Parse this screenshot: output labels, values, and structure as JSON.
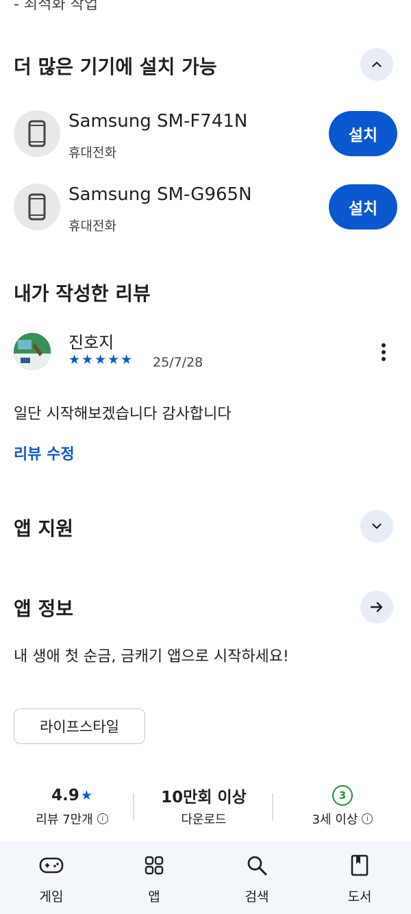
{
  "top_cut_text": "- 최적화 작업",
  "devices_section": {
    "title": "더 많은 기기에 설치 가능",
    "devices": [
      {
        "name": "Samsung SM-F741N",
        "type": "휴대전화",
        "button": "설치"
      },
      {
        "name": "Samsung SM-G965N",
        "type": "휴대전화",
        "button": "설치"
      }
    ]
  },
  "review_section": {
    "title": "내가 작성한 리뷰",
    "author": "진호지",
    "stars": "★★★★★",
    "date": "25/7/28",
    "text": "일단 시작해보겠습니다 감사합니다",
    "edit_link": "리뷰 수정"
  },
  "support_section": {
    "title": "앱 지원"
  },
  "info_section": {
    "title": "앱 정보",
    "description": "내 생애 첫 순금, 금캐기 앱으로 시작하세요!",
    "category_chip": "라이프스타일"
  },
  "stats": {
    "rating": "4.9",
    "rating_star": "★",
    "reviews": "리뷰 7만개",
    "downloads": "10만회 이상",
    "downloads_label": "다운로드",
    "age_badge": "3",
    "age_label": "3세 이상"
  },
  "bottom_nav": [
    {
      "label": "게임",
      "icon": "gamepad-icon"
    },
    {
      "label": "앱",
      "icon": "apps-grid-icon"
    },
    {
      "label": "검색",
      "icon": "search-icon"
    },
    {
      "label": "도서",
      "icon": "book-icon"
    }
  ],
  "colors": {
    "accent": "#0b57d0",
    "age_green": "#1e8e3e",
    "nav_bg": "#f3f6fb"
  }
}
